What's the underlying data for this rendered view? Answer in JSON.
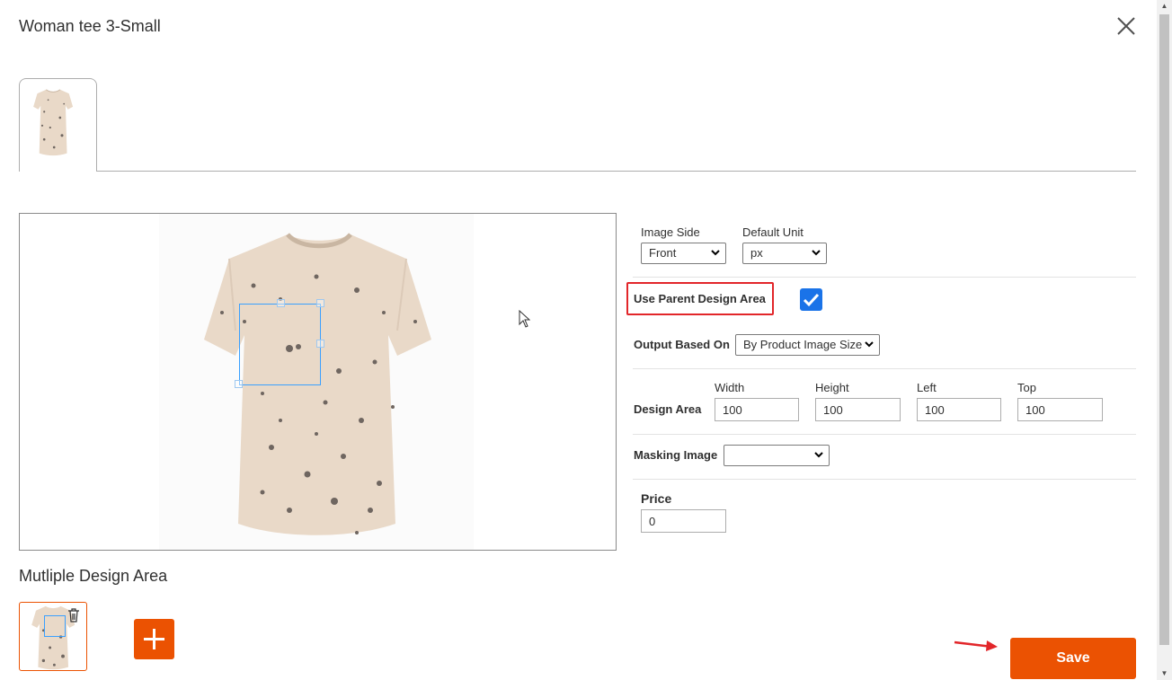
{
  "header": {
    "title": "Woman tee 3-Small"
  },
  "icons": {
    "close": "close-icon",
    "trash": "trash-icon",
    "add": "plus-icon",
    "checkbox": "check-icon",
    "cursor": "mouse-cursor-icon",
    "arrow": "red-arrow-icon"
  },
  "colors": {
    "accent": "#eb5202",
    "checkbox": "#1a73e8",
    "design_area": "#3aa0ff",
    "highlight": "#e2262a",
    "shirt": "#e9d9c8"
  },
  "form": {
    "image_side_label": "Image Side",
    "image_side_value": "Front",
    "default_unit_label": "Default Unit",
    "default_unit_value": "px",
    "use_parent_label": "Use Parent Design Area",
    "use_parent_checked": true,
    "output_label": "Output Based On",
    "output_value": "By Product Image Size",
    "design_area_label": "Design Area",
    "width_label": "Width",
    "width_value": "100",
    "height_label": "Height",
    "height_value": "100",
    "left_label": "Left",
    "left_value": "100",
    "top_label": "Top",
    "top_value": "100",
    "masking_label": "Masking Image",
    "masking_value": "",
    "price_label": "Price",
    "price_value": "0"
  },
  "multi": {
    "title": "Mutliple Design Area"
  },
  "actions": {
    "save_label": "Save"
  }
}
